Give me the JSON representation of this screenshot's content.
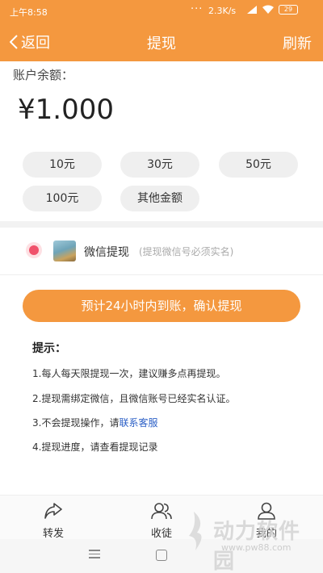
{
  "status_bar": {
    "time": "上午8:58",
    "dots": "···",
    "speed": "2.3K/s",
    "battery": "29"
  },
  "header": {
    "back_label": "返回",
    "title": "提现",
    "refresh_label": "刷新"
  },
  "account": {
    "balance_label": "账户余额：",
    "balance_amount": "¥1.000"
  },
  "amount_options": [
    "10元",
    "30元",
    "50元",
    "100元",
    "其他金额"
  ],
  "withdraw_method": {
    "label": "微信提现",
    "note": "(提现微信号必须实名)",
    "selected": true
  },
  "confirm_button_label": "预计24小时内到账，确认提现",
  "tips": {
    "title": "提示：",
    "items": [
      "1.每人每天限提现一次，建议赚多点再提现。",
      "2.提现需绑定微信，且微信账号已经实名认证。",
      "3.不会提现操作，请",
      "4.提现进度，请查看提现记录"
    ],
    "contact_link": "联系客服"
  },
  "bottom_nav": [
    {
      "label": "转发",
      "icon": "share-icon"
    },
    {
      "label": "收徒",
      "icon": "users-icon"
    },
    {
      "label": "我的",
      "icon": "user-icon"
    }
  ],
  "watermark": {
    "text": "动力软件园",
    "url": "www.pw88.com"
  },
  "colors": {
    "accent": "#f4983f",
    "radio": "#f0526b",
    "link": "#2b5fc6"
  }
}
